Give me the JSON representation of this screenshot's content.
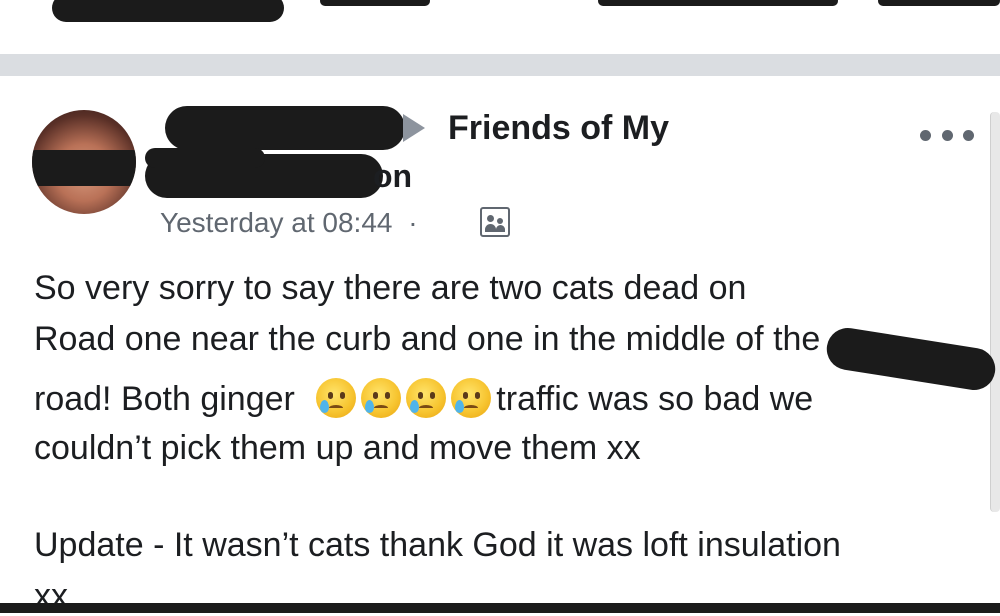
{
  "top_nav": {},
  "post": {
    "group_name": "Friends of My",
    "author_name_tail": "on",
    "timestamp": "Yesterday at 08:44",
    "separator": "·",
    "audience_icon": "group-members-icon",
    "more_icon": "more-options-icon",
    "body_lines": [
      "So very sorry to say there are two cats dead on",
      "Road one near the curb and one in the middle of the",
      "road! Both ginger",
      "couldn’t pick them up and move them xx"
    ],
    "line3_after_emojis": "traffic was so bad we",
    "emoji_name": "crying-face-emoji",
    "update_lines": [
      "Update - It wasn’t cats thank God it was loft insulation",
      "xx"
    ]
  }
}
